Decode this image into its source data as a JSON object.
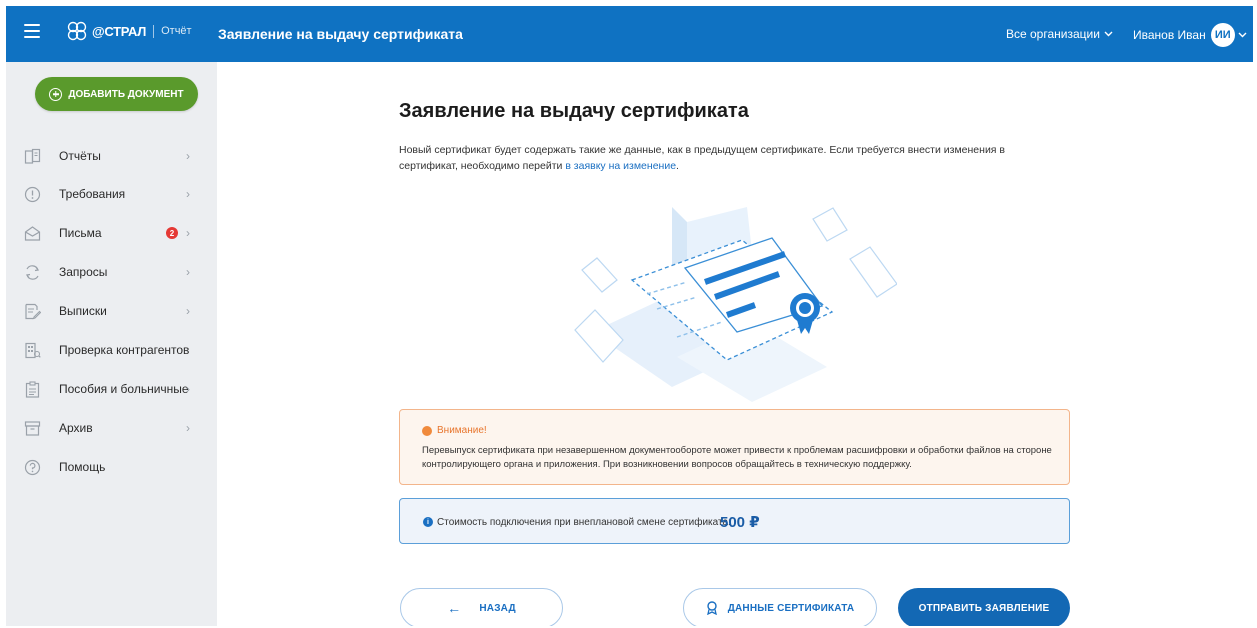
{
  "header": {
    "logo_name": "@СТРАЛ",
    "logo_sub": "Отчёт",
    "page_title": "Заявление на выдачу сертификата",
    "org_select": "Все организации",
    "user_name": "Иванов Иван",
    "user_initials": "ИИ"
  },
  "sidebar": {
    "add_button": "ДОБАВИТЬ ДОКУМЕНТ",
    "items": [
      {
        "label": "Отчёты",
        "icon": "reports-icon",
        "chevron": true
      },
      {
        "label": "Требования",
        "icon": "requirements-icon",
        "chevron": true
      },
      {
        "label": "Письма",
        "icon": "mail-icon",
        "chevron": true,
        "badge": "2"
      },
      {
        "label": "Запросы",
        "icon": "requests-icon",
        "chevron": true
      },
      {
        "label": "Выписки",
        "icon": "statements-icon",
        "chevron": true
      },
      {
        "label": "Проверка контрагентов",
        "icon": "counterparty-icon",
        "chevron": false
      },
      {
        "label": "Пособия и больничные",
        "icon": "benefits-icon",
        "chevron": true
      },
      {
        "label": "Архив",
        "icon": "archive-icon",
        "chevron": true
      },
      {
        "label": "Помощь",
        "icon": "help-icon",
        "chevron": false
      }
    ]
  },
  "main": {
    "title": "Заявление на выдачу сертификата",
    "intro_text": "Новый сертификат будет содержать такие же данные, как в предыдущем сертификате. Если требуется внести изменения в сертификат, необходимо перейти ",
    "intro_link": "в заявку на изменение",
    "intro_end": ".",
    "warning": {
      "title": "Внимание!",
      "text": "Перевыпуск сертификата при незавершенном документообороте может привести к проблемам расшифровки и обработки файлов на стороне контролирующего органа и приложения. При возникновении вопросов обращайтесь в техническую поддержку."
    },
    "cost": {
      "label": "Стоимость подключения при внеплановой смене сертификата:",
      "value": "500 ₽"
    },
    "buttons": {
      "back": "НАЗАД",
      "cert_data": "ДАННЫЕ СЕРТИФИКАТА",
      "send": "ОТПРАВИТЬ ЗАЯВЛЕНИЕ"
    }
  },
  "colors": {
    "brand_blue": "#0f72c2",
    "add_green": "#5a9a2c",
    "warning_orange": "#f08a3c",
    "badge_red": "#e53935"
  }
}
